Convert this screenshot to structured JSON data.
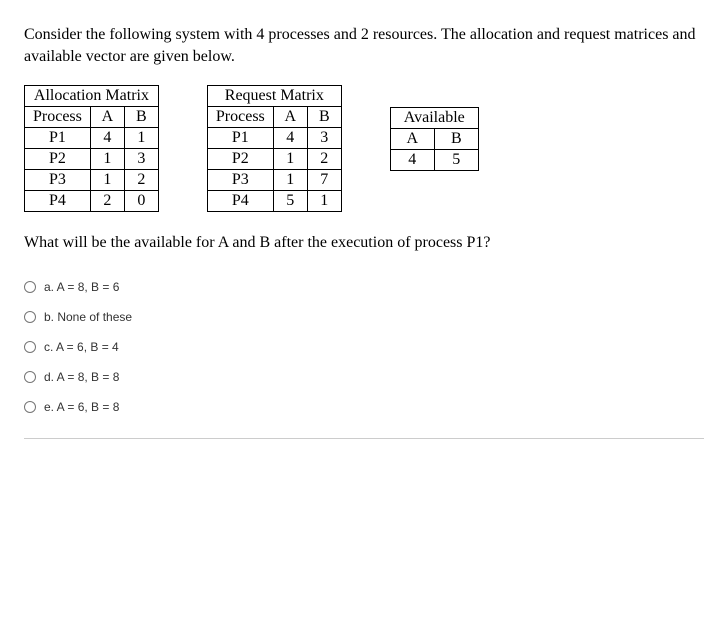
{
  "question": {
    "intro": "Consider the following system with 4 processes and 2 resources. The allocation and request matrices and available vector are given below.",
    "followup": "What will be the available for A and B after the execution of process P1?"
  },
  "allocation": {
    "title": "Allocation Matrix",
    "headers": {
      "process": "Process",
      "a": "A",
      "b": "B"
    },
    "rows": [
      {
        "process": "P1",
        "a": "4",
        "b": "1"
      },
      {
        "process": "P2",
        "a": "1",
        "b": "3"
      },
      {
        "process": "P3",
        "a": "1",
        "b": "2"
      },
      {
        "process": "P4",
        "a": "2",
        "b": "0"
      }
    ]
  },
  "request": {
    "title": "Request Matrix",
    "headers": {
      "process": "Process",
      "a": "A",
      "b": "B"
    },
    "rows": [
      {
        "process": "P1",
        "a": "4",
        "b": "3"
      },
      {
        "process": "P2",
        "a": "1",
        "b": "2"
      },
      {
        "process": "P3",
        "a": "1",
        "b": "7"
      },
      {
        "process": "P4",
        "a": "5",
        "b": "1"
      }
    ]
  },
  "available": {
    "title": "Available",
    "headers": {
      "a": "A",
      "b": "B"
    },
    "values": {
      "a": "4",
      "b": "5"
    }
  },
  "options": {
    "a": "a. A = 8, B = 6",
    "b": "b. None of these",
    "c": "c. A = 6, B = 4",
    "d": "d. A = 8, B = 8",
    "e": "e. A = 6, B = 8"
  }
}
